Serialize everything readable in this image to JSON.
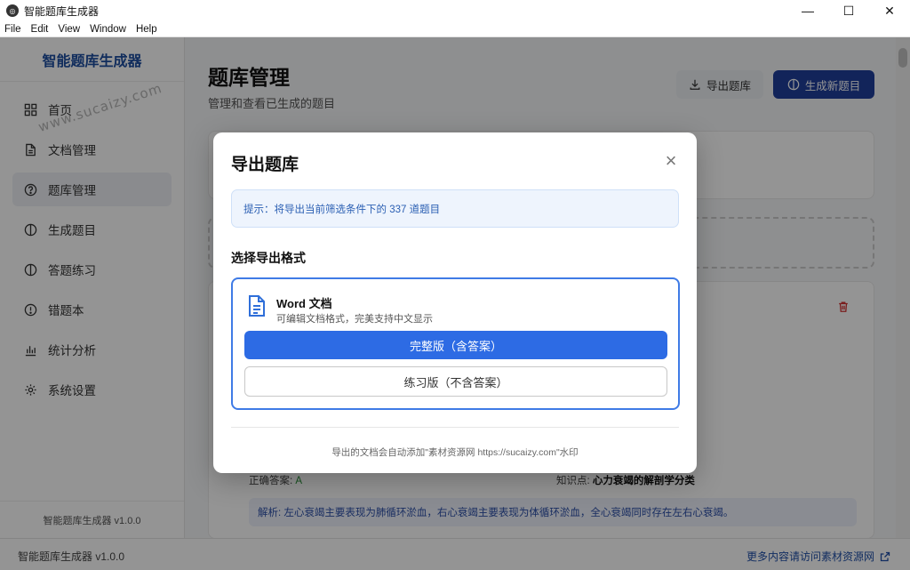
{
  "window": {
    "title": "智能题库生成器",
    "controls": {
      "minimize": "—",
      "maximize": "☐",
      "close": "✕"
    }
  },
  "menu": [
    "File",
    "Edit",
    "View",
    "Window",
    "Help"
  ],
  "sidebar": {
    "brand": "智能题库生成器",
    "items": [
      {
        "label": "首页",
        "icon": "grid-icon"
      },
      {
        "label": "文档管理",
        "icon": "document-icon"
      },
      {
        "label": "题库管理",
        "icon": "question-circle-icon",
        "active": true
      },
      {
        "label": "生成题目",
        "icon": "lightbulb-icon"
      },
      {
        "label": "答题练习",
        "icon": "lightbulb-icon"
      },
      {
        "label": "错题本",
        "icon": "alert-circle-icon"
      },
      {
        "label": "统计分析",
        "icon": "bar-chart-icon"
      },
      {
        "label": "系统设置",
        "icon": "gear-icon"
      }
    ],
    "version": "智能题库生成器 v1.0.0"
  },
  "main": {
    "title": "题库管理",
    "subtitle": "管理和查看已生成的题目",
    "export_button": "导出题库",
    "generate_button": "生成新题目",
    "answer_label": "正确答案: ",
    "answer_value": "A",
    "knowledge_label": "知识点: ",
    "knowledge_value": "心力衰竭的解剖学分类",
    "analysis": "解析: 左心衰竭主要表现为肺循环淤血，右心衰竭主要表现为体循环淤血，全心衰竭同时存在左右心衰竭。"
  },
  "statusbar": {
    "left": "智能题库生成器 v1.0.0",
    "right": "更多内容请访问素材资源网"
  },
  "watermark": "www.sucaizy.com",
  "modal": {
    "title": "导出题库",
    "close": "×",
    "tip": "提示：将导出当前筛选条件下的 337 道题目",
    "section_title": "选择导出格式",
    "format_name": "Word 文档",
    "format_desc": "可编辑文档格式，完美支持中文显示",
    "btn_full": "完整版（含答案）",
    "btn_practice": "练习版（不含答案）",
    "footer": "导出的文档会自动添加\"素材资源网 https://sucaizy.com\"水印"
  },
  "colors": {
    "primary": "#2d6be4",
    "brand": "#1e4ea0",
    "dark_button": "#1f3f9c",
    "tip_text": "#2b5fb3",
    "danger": "#d33333"
  }
}
